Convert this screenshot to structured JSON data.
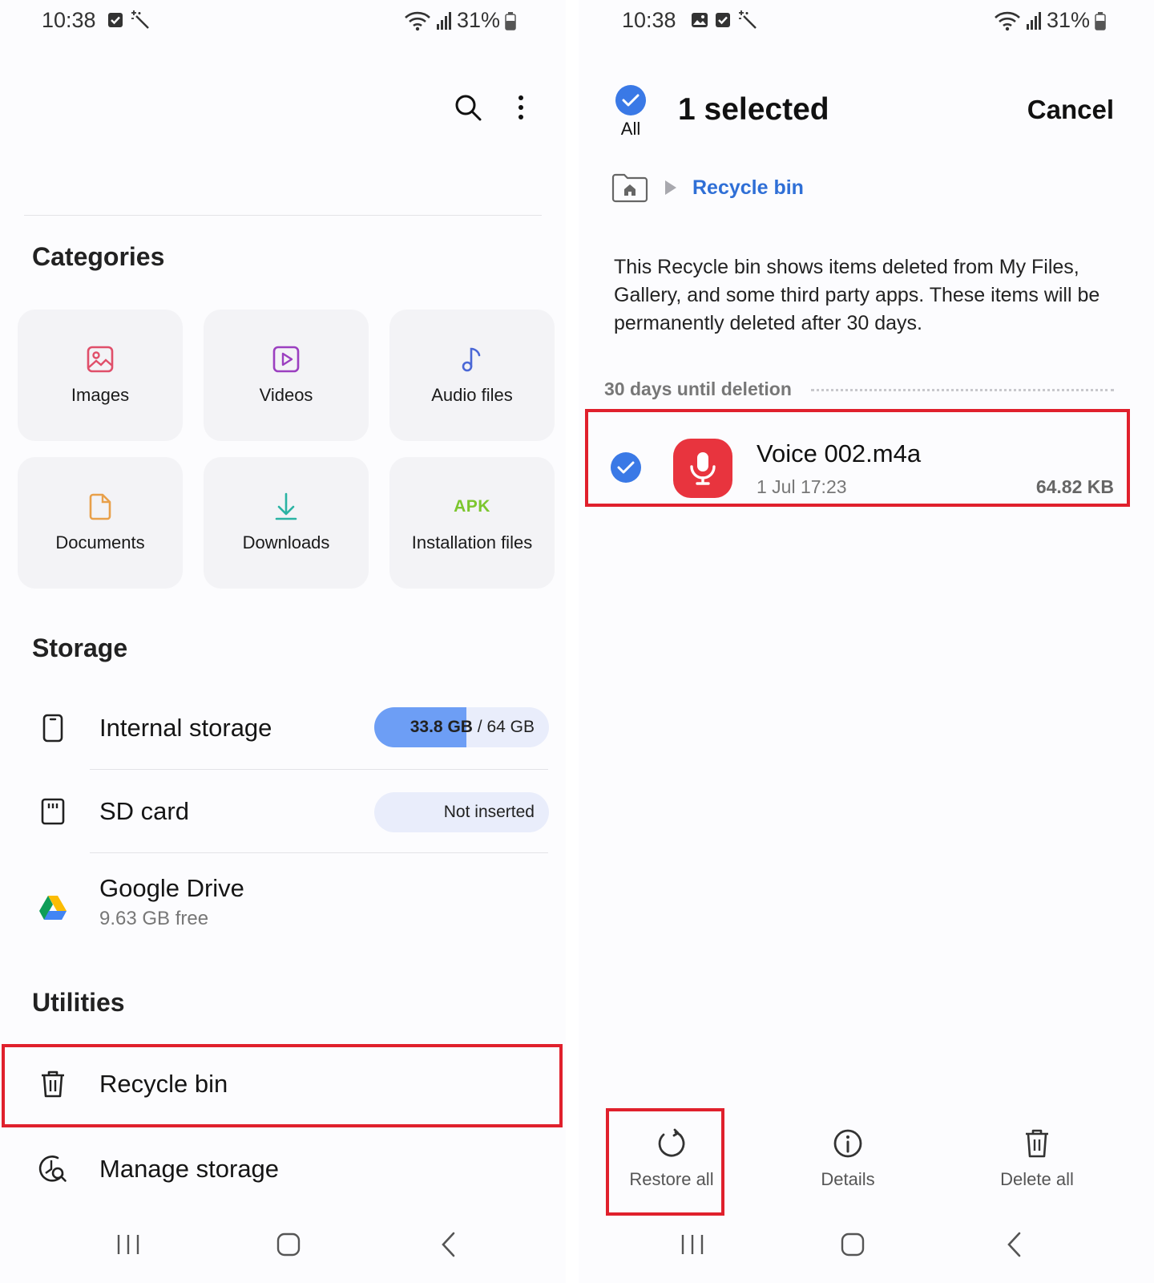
{
  "left": {
    "status": {
      "time": "10:38",
      "battery": "31%"
    },
    "categories": {
      "title": "Categories",
      "items": [
        {
          "label": "Images",
          "icon": "image-icon",
          "color": "#e04f6a"
        },
        {
          "label": "Videos",
          "icon": "video-icon",
          "color": "#9b3fc0"
        },
        {
          "label": "Audio files",
          "icon": "music-note-icon",
          "color": "#4a67d6"
        },
        {
          "label": "Documents",
          "icon": "document-icon",
          "color": "#e8a04a"
        },
        {
          "label": "Downloads",
          "icon": "download-icon",
          "color": "#2ab3a3"
        },
        {
          "label": "Installation files",
          "icon": "apk-icon",
          "icon_text": "APK",
          "color": "#7cc62e"
        }
      ]
    },
    "storage": {
      "title": "Storage",
      "internal": {
        "label": "Internal storage",
        "used": "33.8 GB",
        "total": "/ 64 GB",
        "used_fraction": 0.528
      },
      "sd": {
        "label": "SD card",
        "status": "Not inserted"
      },
      "drive": {
        "label": "Google Drive",
        "free": "9.63 GB free"
      }
    },
    "utilities": {
      "title": "Utilities",
      "recycle": "Recycle bin",
      "manage": "Manage storage"
    }
  },
  "right": {
    "status": {
      "time": "10:38",
      "battery": "31%"
    },
    "header": {
      "all_label": "All",
      "title": "1 selected",
      "cancel": "Cancel"
    },
    "breadcrumb": {
      "current": "Recycle bin"
    },
    "info": "This Recycle bin shows items deleted from My Files, Gallery, and some third party apps. These items will be permanently deleted after 30 days.",
    "group_label": "30 days until deletion",
    "file": {
      "name": "Voice 002.m4a",
      "date": "1 Jul 17:23",
      "size": "64.82 KB"
    },
    "actions": {
      "restore": "Restore all",
      "details": "Details",
      "delete": "Delete all"
    }
  },
  "colors": {
    "accent": "#3a79e6",
    "highlight": "#e0202c",
    "storage_fill": "#6d9ef5"
  }
}
